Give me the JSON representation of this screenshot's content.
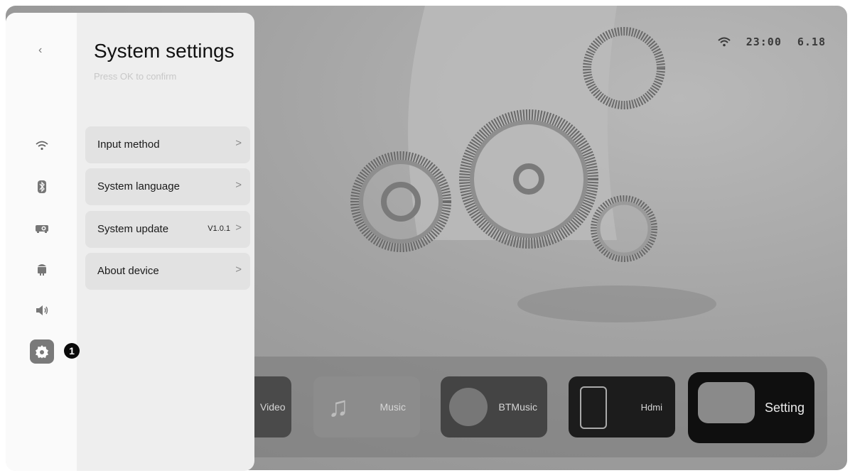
{
  "status": {
    "time": "23:00",
    "date": "6.18",
    "wifi_icon": "wifi-icon"
  },
  "panel": {
    "title": "System settings",
    "subtitle": "Press OK to confirm",
    "back_icon": "‹",
    "rail": [
      {
        "icon": "wifi-icon"
      },
      {
        "icon": "bluetooth-icon"
      },
      {
        "icon": "projector-icon"
      },
      {
        "icon": "android-icon"
      },
      {
        "icon": "speaker-icon"
      },
      {
        "icon": "gear-icon",
        "active": true
      }
    ],
    "items": [
      {
        "label": "Input method",
        "value": "",
        "chevron": ">"
      },
      {
        "label": "System language",
        "value": "",
        "chevron": ">"
      },
      {
        "label": "System update",
        "value": "V1.0.1",
        "chevron": ">"
      },
      {
        "label": "About device",
        "value": "",
        "chevron": ">"
      }
    ]
  },
  "callout": "1",
  "dock": {
    "apps": [
      {
        "label": "Video"
      },
      {
        "label": "Music"
      },
      {
        "label": "BTMusic"
      },
      {
        "label": "Hdmi"
      },
      {
        "label": "Setting",
        "selected": true
      }
    ]
  },
  "colors": {
    "panel_bg": "#eeeeee",
    "rail_bg": "#fafafa",
    "active_icon_bg": "#7a7a7a",
    "backdrop": "#a3a3a3"
  }
}
